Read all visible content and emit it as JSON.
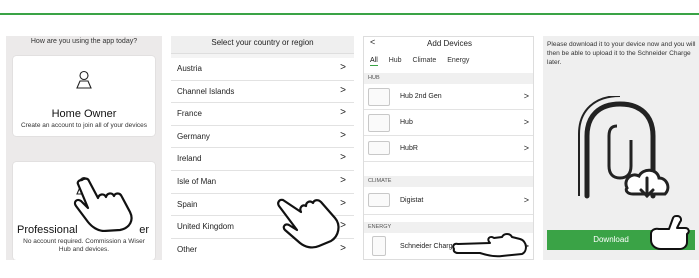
{
  "colors": {
    "brand_green": "#3aa346"
  },
  "panel1": {
    "title": "How are you using the app today?",
    "home_owner": {
      "icon": "person-icon",
      "title": "Home Owner",
      "description": "Create an account to join all of your devices"
    },
    "professional": {
      "icon": "person-icon",
      "title": "Professional Installer",
      "title_visible": "Professional",
      "title_tail": "er",
      "description": "No account required. Commission a Wiser Hub and devices."
    }
  },
  "panel2": {
    "title": "Select your country or region",
    "countries": [
      "Austria",
      "Channel Islands",
      "France",
      "Germany",
      "Ireland",
      "Isle of Man",
      "Spain",
      "United Kingdom",
      "Other"
    ]
  },
  "panel3": {
    "back": "<",
    "title": "Add Devices",
    "tabs": [
      "All",
      "Hub",
      "Climate",
      "Energy"
    ],
    "sections": {
      "hub": {
        "label": "HUB",
        "items": [
          "Hub 2nd Gen",
          "Hub",
          "HubR"
        ]
      },
      "climate": {
        "label": "CLIMATE",
        "items": [
          "Digistat"
        ]
      },
      "energy": {
        "label": "ENERGY",
        "items": [
          "Schneider Charge"
        ]
      }
    }
  },
  "panel4": {
    "message": "Please download it to your device now and you will then be able to upload it to the Schneider Charge later.",
    "button": "Download",
    "illustration_icon": "charger-cloud-download-icon"
  }
}
